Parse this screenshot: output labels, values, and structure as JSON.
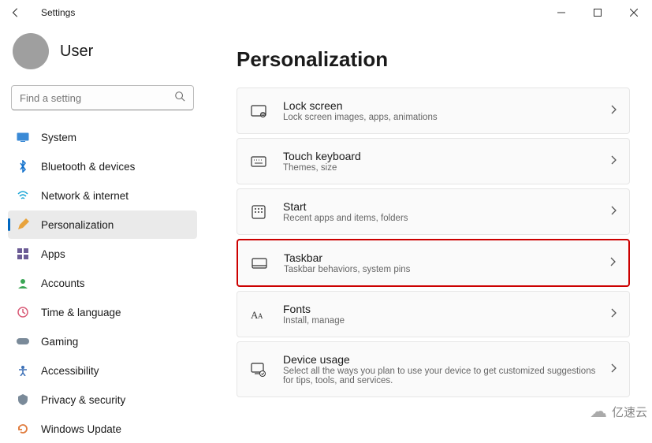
{
  "window": {
    "title": "Settings"
  },
  "user": {
    "name": "User"
  },
  "search": {
    "placeholder": "Find a setting"
  },
  "sidebar": {
    "items": [
      {
        "label": "System"
      },
      {
        "label": "Bluetooth & devices"
      },
      {
        "label": "Network & internet"
      },
      {
        "label": "Personalization"
      },
      {
        "label": "Apps"
      },
      {
        "label": "Accounts"
      },
      {
        "label": "Time & language"
      },
      {
        "label": "Gaming"
      },
      {
        "label": "Accessibility"
      },
      {
        "label": "Privacy & security"
      },
      {
        "label": "Windows Update"
      }
    ]
  },
  "main": {
    "title": "Personalization",
    "items": [
      {
        "title": "Lock screen",
        "sub": "Lock screen images, apps, animations"
      },
      {
        "title": "Touch keyboard",
        "sub": "Themes, size"
      },
      {
        "title": "Start",
        "sub": "Recent apps and items, folders"
      },
      {
        "title": "Taskbar",
        "sub": "Taskbar behaviors, system pins"
      },
      {
        "title": "Fonts",
        "sub": "Install, manage"
      },
      {
        "title": "Device usage",
        "sub": "Select all the ways you plan to use your device to get customized suggestions for tips, tools, and services."
      }
    ]
  },
  "watermark": "亿速云"
}
